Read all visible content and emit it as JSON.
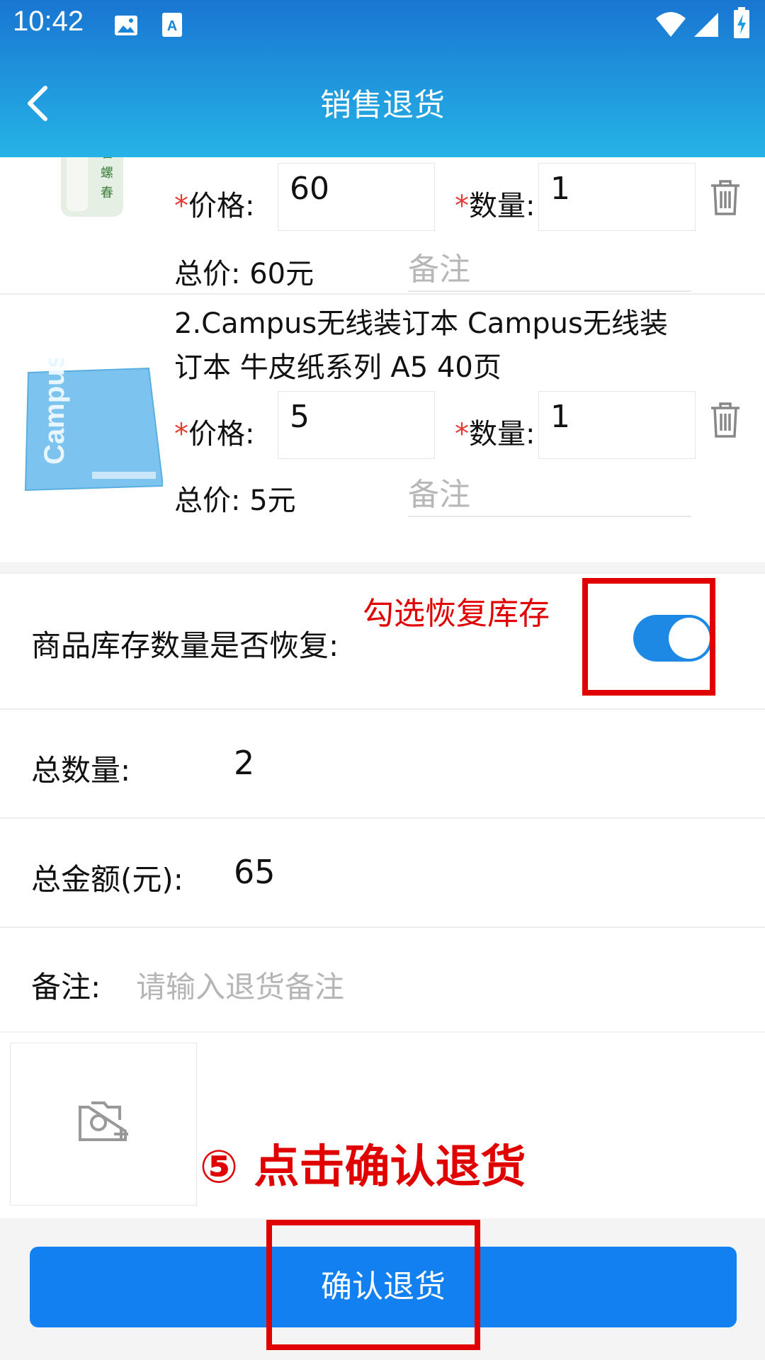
{
  "status_bar": {
    "time": "10:42"
  },
  "nav": {
    "title": "销售退货",
    "back_icon": "chevron-left-icon"
  },
  "items": [
    {
      "index_label": "",
      "price_label": "价格:",
      "price_value": "60",
      "qty_label": "数量:",
      "qty_value": "1",
      "total_text": "总价: 60元",
      "remark_placeholder": "备注"
    },
    {
      "name": "2.Campus无线装订本 Campus无线装订本 牛皮纸系列 A5 40页",
      "name_line1": "2.Campus无线装订本 Campus无线装",
      "name_line2": "订本 牛皮纸系列 A5 40页",
      "price_label": "价格:",
      "price_value": "5",
      "qty_label": "数量:",
      "qty_value": "1",
      "total_text": "总价: 5元",
      "remark_placeholder": "备注"
    }
  ],
  "required_mark": "*",
  "restore_stock": {
    "label": "商品库存数量是否恢复:",
    "enabled": true
  },
  "summary": {
    "total_qty_label": "总数量:",
    "total_qty_value": "2",
    "total_amount_label": "总金额(元):",
    "total_amount_value": "65",
    "remark_label": "备注:",
    "remark_placeholder": "请输入退货备注"
  },
  "photo": {
    "icon": "camera-add-icon"
  },
  "confirm_button": "确认退货",
  "annotations": {
    "restore_hint": "勾选恢复库存",
    "step_hint": "⑤ 点击确认退货",
    "color": "#e00000"
  },
  "colors": {
    "accent": "#1280f0",
    "header_top": "#1976d2",
    "header_bottom": "#26b3e6",
    "required": "#e53935"
  }
}
